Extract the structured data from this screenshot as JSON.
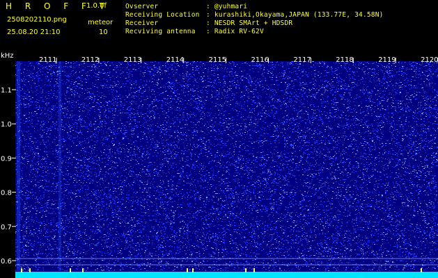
{
  "header": {
    "logo": "H R O F F T",
    "version": "1.0.0f",
    "filename": "2508202110.png",
    "datetime": "25.08.20 21:10",
    "mode_label": "meteor",
    "mode_value": "10",
    "info": [
      {
        "label": "Ovserver",
        "value": ": @yuhmari"
      },
      {
        "label": "Receiving Location",
        "value": ": kurashiki,Okayama,JAPAN (133.77E, 34.58N)"
      },
      {
        "label": "Receiver",
        "value": ": NESDR SMArt + HDSDR"
      },
      {
        "label": "Recviving antenna",
        "value": ": Radix RV-62V"
      }
    ]
  },
  "chart_data": {
    "type": "heatmap",
    "ylabel": "kHz",
    "y_ticks": [
      1.1,
      1.0,
      0.9,
      0.8,
      0.7,
      0.6
    ],
    "y_tick_labels": [
      "1.1",
      "1.0",
      "0.9",
      "0.8",
      "0.7",
      "0.6"
    ],
    "ylim": [
      0.57,
      1.2
    ],
    "x_ticks": [
      "2111",
      "2112",
      "2113",
      "2114",
      "2115",
      "2116",
      "2117",
      "2118",
      "2119",
      "2120"
    ],
    "grid": false,
    "colors": {
      "background": "#000080",
      "noise": "#1f3cff",
      "noise_bright": "#6aa8ff",
      "baseline": "#00e5ff",
      "header_text": "#ffff33"
    }
  }
}
